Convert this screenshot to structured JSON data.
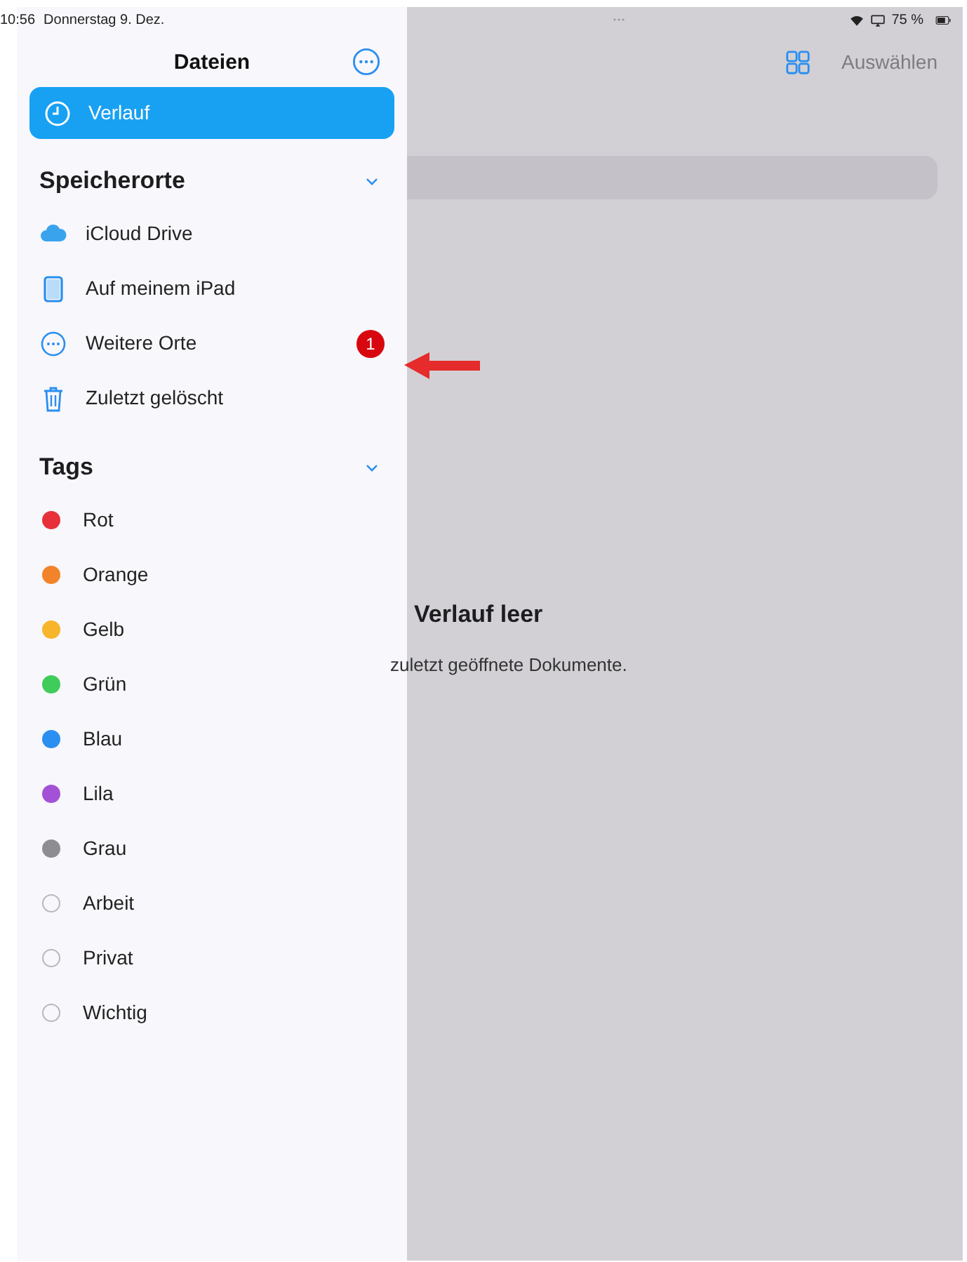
{
  "status_bar": {
    "time": "10:56",
    "date": "Donnerstag 9. Dez.",
    "battery": "75 %"
  },
  "sidebar": {
    "title": "Dateien",
    "items": [
      {
        "label": "Verlauf",
        "kind": "clock",
        "selected": true
      }
    ],
    "sections": [
      {
        "title": "Speicherorte",
        "expanded": true,
        "items": [
          {
            "label": "iCloud Drive",
            "kind": "cloud",
            "selected": false
          },
          {
            "label": "Auf meinem iPad",
            "kind": "tablet",
            "selected": false
          },
          {
            "label": "Weitere Orte",
            "kind": "more",
            "selected": false,
            "badge": "1"
          },
          {
            "label": "Zuletzt gelöscht",
            "kind": "trash",
            "selected": false
          }
        ]
      },
      {
        "title": "Tags",
        "expanded": true,
        "items": [
          {
            "label": "Rot",
            "kind": "tag",
            "color": "#e8303a",
            "selected": false
          },
          {
            "label": "Orange",
            "kind": "tag",
            "color": "#f2832a",
            "selected": false
          },
          {
            "label": "Gelb",
            "kind": "tag",
            "color": "#f6b52a",
            "selected": false
          },
          {
            "label": "Grün",
            "kind": "tag",
            "color": "#3fcc5a",
            "selected": false
          },
          {
            "label": "Blau",
            "kind": "tag",
            "color": "#2a8ff0",
            "selected": false
          },
          {
            "label": "Lila",
            "kind": "tag",
            "color": "#a352d6",
            "selected": false
          },
          {
            "label": "Grau",
            "kind": "tag",
            "color": "#8e8d92",
            "selected": false
          },
          {
            "label": "Arbeit",
            "kind": "tag",
            "selected": false
          },
          {
            "label": "Privat",
            "kind": "tag",
            "selected": false
          },
          {
            "label": "Wichtig",
            "kind": "tag",
            "selected": false
          }
        ]
      }
    ]
  },
  "toolbar": {
    "select_button": "Auswählen",
    "select_disabled": true
  },
  "empty_state": {
    "title": "Verlauf leer",
    "message": "zuletzt geöffnete Dokumente."
  }
}
